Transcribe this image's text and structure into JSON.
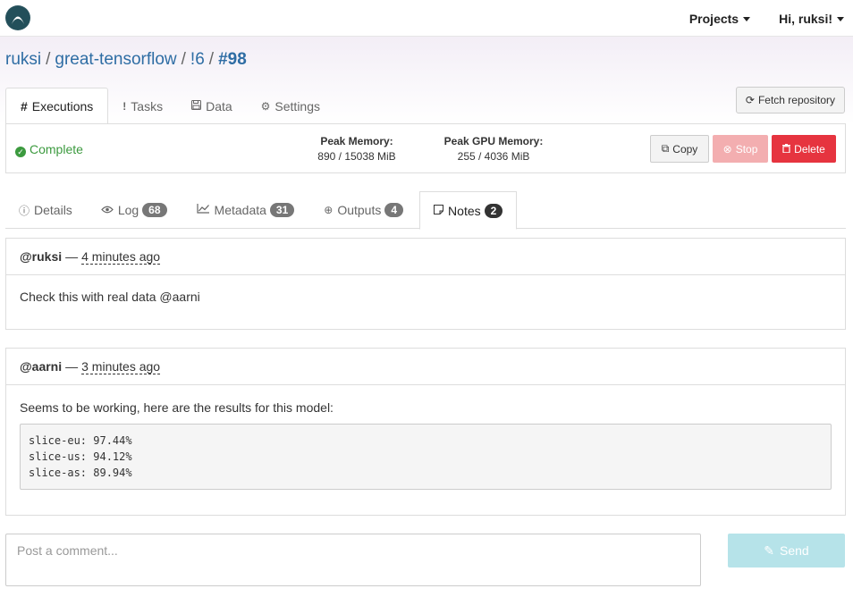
{
  "nav": {
    "logo": "valohai-logo",
    "projects_label": "Projects",
    "user_label": "Hi, ruksi!"
  },
  "breadcrumb": {
    "owner": "ruksi",
    "project": "great-tensorflow",
    "run": "!6",
    "execution": "#98",
    "separator": "/"
  },
  "main_tabs": [
    {
      "icon": "#",
      "label": "Executions",
      "active": true
    },
    {
      "icon": "!",
      "label": "Tasks",
      "active": false
    },
    {
      "icon": "💾",
      "label": "Data",
      "active": false
    },
    {
      "icon": "⚙",
      "label": "Settings",
      "active": false
    }
  ],
  "fetch_button": {
    "icon": "⟳",
    "label": "Fetch repository"
  },
  "status": {
    "label": "Complete",
    "color": "#3c9a3f"
  },
  "peak_memory": {
    "label": "Peak Memory:",
    "value": "890 / 15038 MiB"
  },
  "peak_gpu_memory": {
    "label": "Peak GPU Memory:",
    "value": "255 / 4036 MiB"
  },
  "actions": {
    "copy": {
      "icon": "⧉",
      "label": "Copy"
    },
    "stop": {
      "icon": "⊗",
      "label": "Stop"
    },
    "delete": {
      "icon": "🗑",
      "label": "Delete",
      "color": "#e6343f"
    }
  },
  "sub_tabs": [
    {
      "icon": "ⓘ",
      "label": "Details",
      "badge": ""
    },
    {
      "icon": "👁",
      "label": "Log",
      "badge": "68"
    },
    {
      "icon": "📈",
      "label": "Metadata",
      "badge": "31"
    },
    {
      "icon": "⊕",
      "label": "Outputs",
      "badge": "4"
    },
    {
      "icon": "☐",
      "label": "Notes",
      "badge": "2"
    }
  ],
  "notes": [
    {
      "author": "@ruksi",
      "dash": "—",
      "time": "4 minutes ago",
      "text": "Check this with real data @aarni"
    },
    {
      "author": "@aarni",
      "dash": "—",
      "time": "3 minutes ago",
      "text": "Seems to be working, here are the results for this model:",
      "code": "slice-eu: 97.44%\nslice-us: 94.12%\nslice-as: 89.94%"
    }
  ],
  "comment": {
    "placeholder": "Post a comment...",
    "send_label": "Send",
    "send_icon": "✎"
  }
}
